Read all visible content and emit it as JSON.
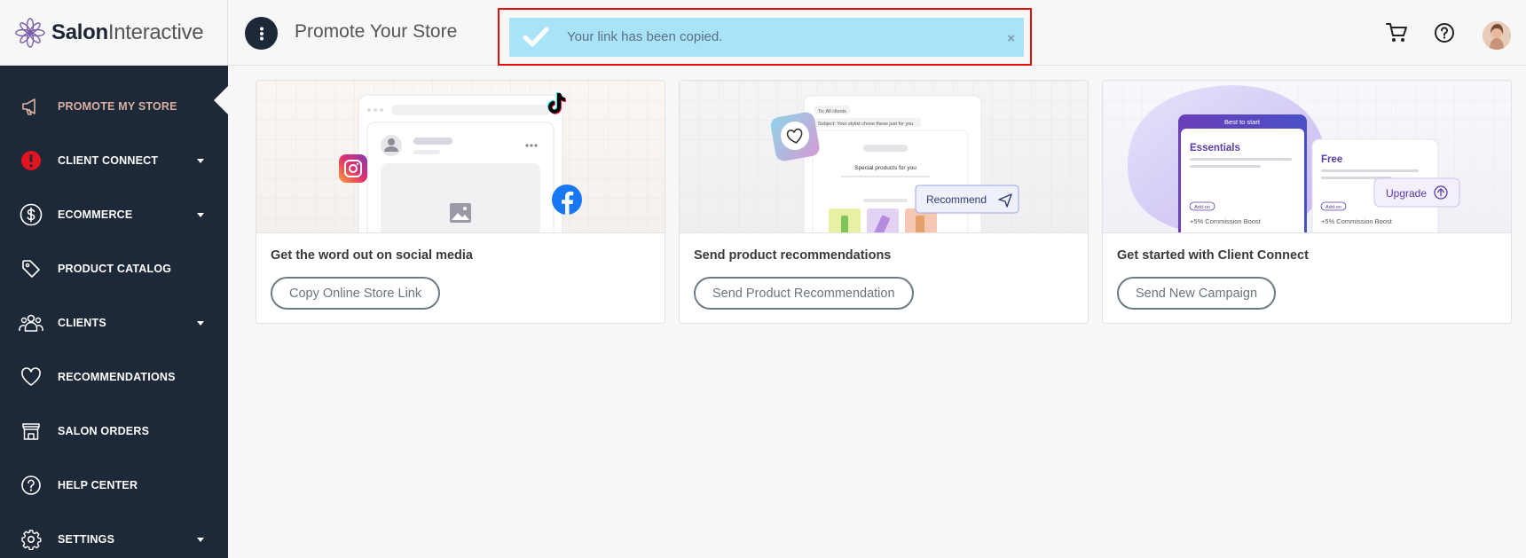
{
  "app": {
    "logo_bold": "Salon",
    "logo_light": "Interactive",
    "page_title": "Promote Your Store"
  },
  "toast": {
    "message": "Your link has been copied.",
    "close": "×",
    "color": "#a8e3f8",
    "highlight_color": "#e01010"
  },
  "sidebar": {
    "items": [
      {
        "label": "PROMOTE MY STORE",
        "icon": "megaphone-icon",
        "active": true,
        "has_caret": false
      },
      {
        "label": "CLIENT CONNECT",
        "icon": "alert-icon",
        "active": false,
        "has_caret": true
      },
      {
        "label": "ECOMMERCE",
        "icon": "dollar-icon",
        "active": false,
        "has_caret": true
      },
      {
        "label": "PRODUCT CATALOG",
        "icon": "tag-icon",
        "active": false,
        "has_caret": false
      },
      {
        "label": "CLIENTS",
        "icon": "users-icon",
        "active": false,
        "has_caret": true
      },
      {
        "label": "RECOMMENDATIONS",
        "icon": "heart-icon",
        "active": false,
        "has_caret": false
      },
      {
        "label": "SALON ORDERS",
        "icon": "store-icon",
        "active": false,
        "has_caret": false
      },
      {
        "label": "HELP CENTER",
        "icon": "help-icon",
        "active": false,
        "has_caret": false
      },
      {
        "label": "SETTINGS",
        "icon": "gear-icon",
        "active": false,
        "has_caret": true
      }
    ],
    "background": "#1d2838",
    "active_label_color": "#d9b0a0"
  },
  "cards": [
    {
      "heading": "Get the word out on social media",
      "button": "Copy Online Store Link"
    },
    {
      "heading": "Send product recommendations",
      "button": "Send Product Recommendation",
      "illus": {
        "to": "To: All clients",
        "subject": "Subject: Your stylist chose these just for you",
        "special": "Special products for you",
        "recommend": "Recommend"
      }
    },
    {
      "heading": "Get started with Client Connect",
      "button": "Send New Campaign",
      "illus": {
        "best": "Best to start",
        "essentials": "Essentials",
        "free": "Free",
        "addon1": "Add-on",
        "addon2": "Add-on",
        "boost1": "+5% Commission Boost",
        "boost2": "+5% Commission Boost",
        "upgrade": "Upgrade"
      }
    }
  ]
}
